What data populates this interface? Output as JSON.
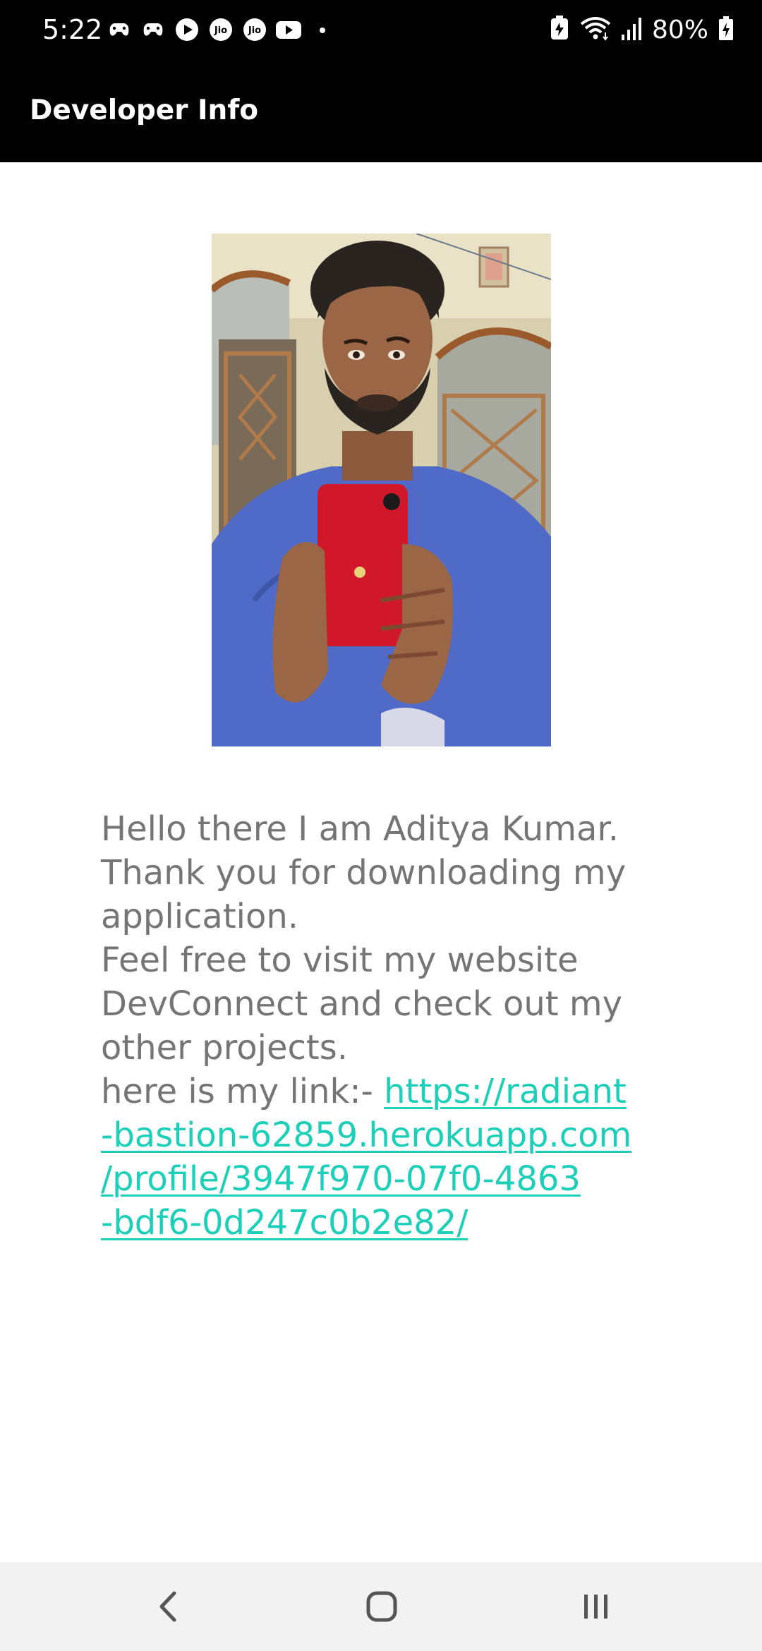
{
  "status_bar": {
    "time": "5:22",
    "battery_percent": "80%",
    "icons_left": [
      "game-controller-icon",
      "game-controller-icon",
      "play-icon",
      "jio-icon",
      "jio-icon",
      "youtube-icon",
      "dot-icon"
    ],
    "icons_right": [
      "battery-saver-icon",
      "wifi-icon",
      "signal-icon",
      "battery-charging-icon"
    ]
  },
  "app_bar": {
    "title": "Developer Info"
  },
  "profile": {
    "photo": "developer-photo"
  },
  "info": {
    "line1": "Hello there I am Aditya Kumar.",
    "line2": "Thank you for downloading my",
    "line3": "application.",
    "line4": "Feel free to visit my website",
    "line5": "DevConnect and check out my",
    "line6": "other projects.",
    "link_prefix": "here is my link:- ",
    "link_part1": "https://radiant",
    "link_part2": "-bastion-62859.herokuapp.com",
    "link_part3": "/profile/3947f970-07f0-4863",
    "link_part4": "-bdf6-0d247c0b2e82/"
  },
  "colors": {
    "app_bar_bg": "#000000",
    "text_gray": "#757575",
    "link_teal": "#1ccfb8",
    "nav_bar_bg": "#f2f2f2"
  },
  "nav_bar": {
    "buttons": [
      "back-icon",
      "home-icon",
      "recent-apps-icon"
    ]
  }
}
